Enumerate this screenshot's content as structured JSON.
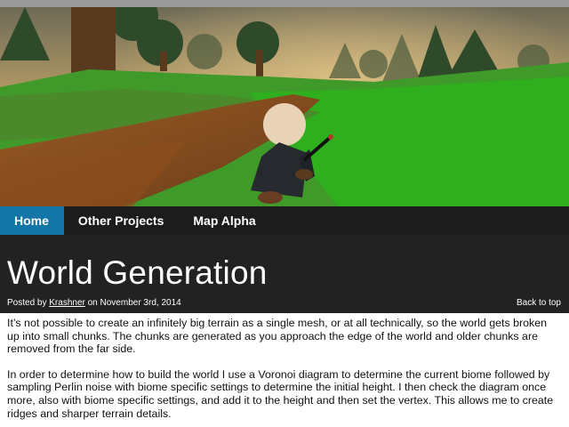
{
  "nav": {
    "items": [
      {
        "label": "Home",
        "active": true
      },
      {
        "label": "Other Projects",
        "active": false
      },
      {
        "label": "Map Alpha",
        "active": false
      }
    ]
  },
  "post": {
    "title": "World Generation",
    "posted_by_prefix": "Posted by",
    "author": "Krashner",
    "date_text": "on November 3rd, 2014",
    "back_to_top": "Back to top",
    "paragraphs": [
      "It’s not possible to create an infinitely big terrain as a single mesh, or at all technically, so the world gets broken up into small chunks. The chunks are generated as you approach the edge of the world and older chunks are removed from the far side.",
      "In order to determine how to build the world I use a Voronoi diagram to determine the current biome followed by sampling Perlin noise with biome specific settings to determine the initial height. I then check the diagram once more, also with biome specific settings, and add it to the height and then set the vertex. This allows me to create ridges and sharper terrain details."
    ]
  },
  "colors": {
    "nav_bg": "#1c1c1c",
    "nav_active": "#1475a8",
    "header_bg": "#222222"
  },
  "hero": {
    "icon": "game-screenshot-low-poly-forest-character"
  }
}
